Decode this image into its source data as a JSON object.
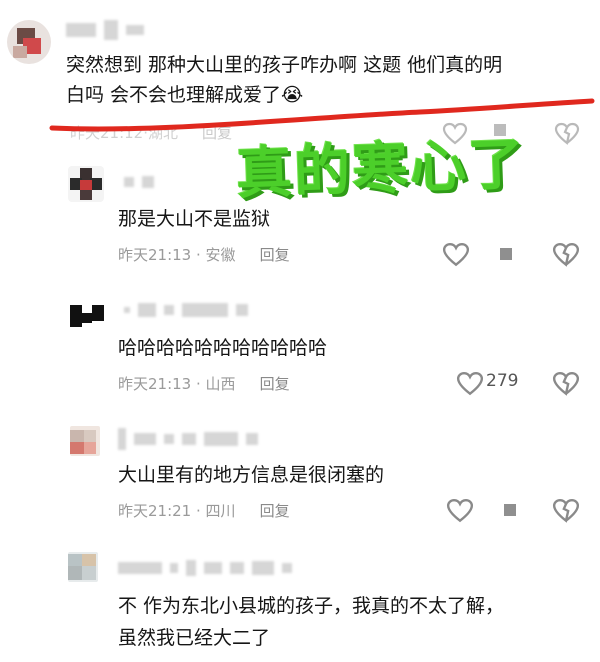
{
  "comments": [
    {
      "text_lines": [
        "突然想到 那种大山里的孩子咋办啊 这题 他们真的明",
        "白吗 会不会也理解成爱了😭"
      ],
      "time": "昨天21:12",
      "location": "湖北",
      "reply": "回复"
    },
    {
      "text_lines": [
        "那是大山不是监狱"
      ],
      "time": "昨天21:13",
      "location": "安徽",
      "reply": "回复"
    },
    {
      "text_lines": [
        "哈哈哈哈哈哈哈哈哈哈哈"
      ],
      "time": "昨天21:13",
      "location": "山西",
      "reply": "回复",
      "likes": "279"
    },
    {
      "text_lines": [
        "大山里有的地方信息是很闭塞的"
      ],
      "time": "昨天21:21",
      "location": "四川",
      "reply": "回复"
    },
    {
      "text_lines": [
        "不 作为东北小县城的孩子，我真的不太了解，",
        "虽然我已经大二了"
      ]
    }
  ],
  "overlay": {
    "text": "真的寒心了",
    "color": "#4ccf2a"
  },
  "colors": {
    "underline": "#e0281e",
    "icon": "#8a8a8a"
  },
  "icons": {
    "like": "heart-outline-icon",
    "dislike": "broken-heart-icon"
  }
}
